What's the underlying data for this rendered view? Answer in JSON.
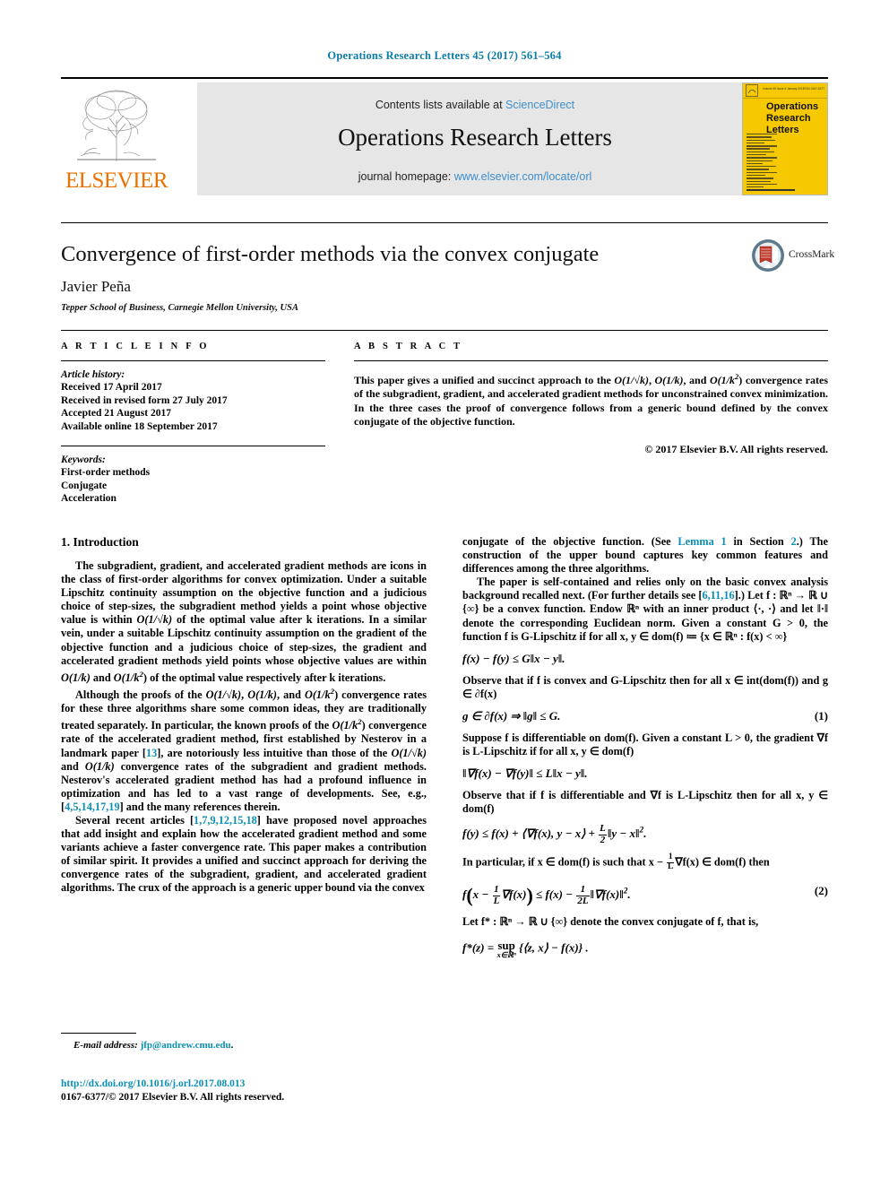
{
  "running_head": "Operations Research Letters 45 (2017) 561–564",
  "masthead": {
    "publisher_name": "ELSEVIER",
    "contents_prefix": "Contents lists available at ",
    "contents_link": "ScienceDirect",
    "journal_title": "Operations Research Letters",
    "homepage_prefix": "journal homepage: ",
    "homepage_link": "www.elsevier.com/locate/orl",
    "cover": {
      "line1": "Operations",
      "line2": "Research",
      "line3": "Letters",
      "header_left": "Volume 45 Issue 6 January 2017",
      "header_right": "ISSN 0167-6377"
    }
  },
  "article": {
    "title": "Convergence of first-order methods via the convex conjugate",
    "author": "Javier Peña",
    "affiliation": "Tepper School of Business, Carnegie Mellon University, USA",
    "crossmark_label": "CrossMark"
  },
  "info": {
    "heading": "A R T I C L E   I N F O",
    "history_label": "Article history:",
    "history": [
      "Received 17 April 2017",
      "Received in revised form 27 July 2017",
      "Accepted 21 August 2017",
      "Available online 18 September 2017"
    ],
    "keywords_label": "Keywords:",
    "keywords": [
      "First-order methods",
      "Conjugate",
      "Acceleration"
    ]
  },
  "abstract": {
    "heading": "A B S T R A C T",
    "text_1": "This paper gives a unified and succinct approach to the ",
    "rate_1": "O(1/√k)",
    "text_2": ", ",
    "rate_2": "O(1/k)",
    "text_3": ", and ",
    "rate_3": "O(1/k",
    "rate_3_sup": "2",
    "text_4": ") convergence rates of the subgradient, gradient, and accelerated gradient methods for unconstrained convex minimization. In the three cases the proof of convergence follows from a generic bound defined by the convex conjugate of the objective function.",
    "copyright": "© 2017 Elsevier B.V. All rights reserved."
  },
  "body": {
    "section_heading": "1.  Introduction",
    "left": {
      "p1_a": "The subgradient, gradient, and accelerated gradient methods are icons in the class of first-order algorithms for convex optimization. Under a suitable Lipschitz continuity assumption on the objective function and a judicious choice of step-sizes, the subgradient method yields a point whose objective value is within ",
      "p1_rate": "O(1/√k)",
      "p1_b": " of the optimal value after k iterations. In a similar vein, under a suitable Lipschitz continuity assumption on the gradient of the objective function and a judicious choice of step-sizes, the gradient and accelerated gradient methods yield points whose objective values are within ",
      "p1_rate2": "O(1/k)",
      "p1_c": " and ",
      "p1_rate3": "O(1/k",
      "p1_rate3_sup": "2",
      "p1_d": ") of the optimal value respectively after k iterations.",
      "p2_a": "Although the proofs of the ",
      "p2_rate1": "O(1/√k)",
      "p2_b": ", ",
      "p2_rate2": "O(1/k)",
      "p2_c": ", and ",
      "p2_rate3": "O(1/k",
      "p2_rate3_sup": "2",
      "p2_d": ") convergence rates for these three algorithms share some common ideas, they are traditionally treated separately. In particular, the known proofs of the ",
      "p2_rate4": "O(1/k",
      "p2_rate4_sup": "2",
      "p2_e": ") convergence rate of the accelerated gradient method, first established by Nesterov in a landmark paper [",
      "p2_cite1": "13",
      "p2_f": "], are notoriously less intuitive than those of the ",
      "p2_rate5": "O(1/√k)",
      "p2_g": " and ",
      "p2_rate6": "O(1/k)",
      "p2_h": " convergence rates of the subgradient and gradient methods. Nesterov's accelerated gradient method has had a profound influence in optimization and has led to a vast range of developments. See, e.g., [",
      "p2_cite2": "4,5,14,17,19",
      "p2_i": "] and the many references therein.",
      "p3_a": "Several recent articles [",
      "p3_cite": "1,7,9,12,15,18",
      "p3_b": "] have proposed novel approaches that add insight and explain how the accelerated gradient method and some variants achieve a faster convergence rate. This paper makes a contribution of similar spirit. It provides a unified and succinct approach for deriving the convergence rates of the subgradient, gradient, and accelerated gradient algorithms. The crux of the approach is a generic upper bound via the convex"
    },
    "right": {
      "p1_a": "conjugate of the objective function. (See ",
      "p1_lemma": "Lemma 1",
      "p1_b": " in Section ",
      "p1_section": "2",
      "p1_c": ".) The construction of the upper bound captures key common features and differences among the three algorithms.",
      "p2_a": "The paper is self-contained and relies only on the basic convex analysis background recalled next. (For further details see [",
      "p2_cite": "6,11,16",
      "p2_b": "].) Let f : ℝⁿ → ℝ ∪ {∞} be a convex function. Endow ℝⁿ with an inner product ⟨·, ·⟩ and let ‖·‖ denote the corresponding Euclidean norm. Given a constant G > 0, the function f is G-Lipschitz if for all x, y ∈ dom(f) ≔ {x ∈ ℝⁿ : f(x) < ∞}",
      "eq_a": "f(x) − f(y) ≤ G‖x − y‖.",
      "p3": "Observe that if f is convex and G-Lipschitz then for all x ∈ int(dom(f)) and g ∈ ∂f(x)",
      "eq_1": "g ∈ ∂f(x) ⇒ ‖g‖ ≤ G.",
      "eq_1_num": "(1)",
      "p4": "Suppose f is differentiable on dom(f). Given a constant L > 0, the gradient ∇f is L-Lipschitz if for all x, y ∈ dom(f)",
      "eq_b": "‖∇f(x) − ∇f(y)‖ ≤ L‖x − y‖.",
      "p5": "Observe that if f is differentiable and ∇f is L-Lipschitz then for all x, y ∈ dom(f)",
      "eq_c_1": "f(y) ≤ f(x) + ⟨∇f(x), y − x⟩ + ",
      "eq_c_num": "L",
      "eq_c_den": "2",
      "eq_c_2": "‖y − x‖",
      "eq_c_sup": "2",
      "eq_c_3": ".",
      "p6_a": "In particular, if x ∈ dom(f) is such that x − ",
      "p6_num": "1",
      "p6_den": "L",
      "p6_b": "∇f(x) ∈ dom(f) then",
      "eq_2_1": "f",
      "eq_2_2": "x − ",
      "eq_2_num1": "1",
      "eq_2_den1": "L",
      "eq_2_3": "∇f(x)",
      "eq_2_4": " ≤ f(x) − ",
      "eq_2_num2": "1",
      "eq_2_den2": "2L",
      "eq_2_5": "‖∇f(x)‖",
      "eq_2_sup": "2",
      "eq_2_6": ".",
      "eq_2_num": "(2)",
      "p7": "Let f* : ℝⁿ → ℝ ∪ {∞} denote the convex conjugate of f, that is,",
      "eq_d_1": "f*(z) = ",
      "eq_d_sup": "sup",
      "eq_d_sub": "x∈ℝⁿ",
      "eq_d_2": " {⟨z, x⟩ − f(x)} ."
    }
  },
  "footer": {
    "email_label": "E-mail address:",
    "email": "jfp@andrew.cmu.edu",
    "email_tail": ".",
    "doi": "http://dx.doi.org/10.1016/j.orl.2017.08.013",
    "issn_line": "0167-6377/© 2017 Elsevier B.V. All rights reserved."
  },
  "colors": {
    "link_teal": "#0b8fb5",
    "link_blue": "#3d8fcc",
    "elsevier_orange": "#eb7100",
    "cover_yellow": "#f5c800"
  }
}
